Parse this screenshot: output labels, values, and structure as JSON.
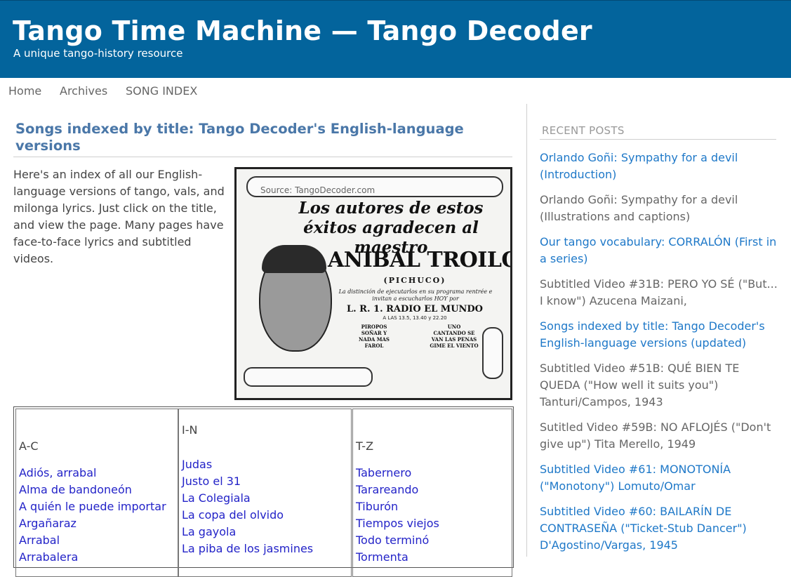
{
  "header": {
    "title": "Tango Time Machine — Tango Decoder",
    "tagline": "A unique tango-history resource",
    "background": "#03649c"
  },
  "nav": {
    "items": [
      {
        "label": "Home"
      },
      {
        "label": "Archives"
      },
      {
        "label": "SONG INDEX"
      }
    ]
  },
  "post": {
    "title": "Songs indexed by title: Tango Decoder's English-language versions",
    "intro": "Here's an index of all our English-language versions of tango, vals, and milonga lyrics. Just click on the title, and view the page. Many pages have face-to-face lyrics and subtitled videos."
  },
  "promo_image": {
    "source": "Source: TangoDecoder.com",
    "headline": "Los autores de estos éxitos agradecen al maestro",
    "name": "ANIBAL TROILO",
    "nickname": "(PICHUCO)",
    "blurb": "La distinción de ejecutarlos en su programa rentrée e invitan a escucharlos HOY por",
    "station": "L. R. 1. RADIO EL MUNDO",
    "times": "A LAS 13.5, 13.40 y 22.20",
    "col_a": [
      "PIROPOS",
      "SOÑAR Y",
      "NADA MAS",
      "FAROL"
    ],
    "col_b": [
      "UNO",
      "CANTANDO SE",
      "VAN LAS PENAS",
      "GIME EL VIENTO"
    ]
  },
  "index": {
    "columns": [
      {
        "heading": "A-C",
        "songs": [
          "Adiós, arrabal",
          "Alma de bandoneón",
          "A quién le puede importar",
          "Argañaraz",
          "Arrabal",
          "Arrabalera"
        ]
      },
      {
        "heading": "I-N",
        "songs": [
          "Judas",
          "Justo el 31",
          "La Colegiala",
          "La copa del olvido",
          "La gayola",
          "La piba de los jasmines"
        ]
      },
      {
        "heading": "T-Z",
        "songs": [
          "Tabernero",
          "Tarareando",
          "Tiburón",
          "Tiempos viejos",
          "Todo terminó",
          "Tormenta"
        ]
      }
    ],
    "link_color": "#2323c8"
  },
  "sidebar": {
    "heading": "RECENT POSTS",
    "posts": [
      {
        "label": "Orlando Goñi: Sympathy for a devil (Introduction)"
      },
      {
        "label": "Orlando Goñi: Sympathy for a devil (Illustrations and captions)"
      },
      {
        "label": "Our tango vocabulary: CORRALÓN (First in a series)"
      },
      {
        "label": "Subtitled Video #31B: PERO YO SÉ (\"But... I know\") Azucena Maizani,"
      },
      {
        "label": "Songs indexed by title: Tango Decoder's English-language versions (updated)"
      },
      {
        "label": "Subtitled Video #51B: QUÉ BIEN TE QUEDA (\"How well it suits you\") Tanturi/Campos, 1943"
      },
      {
        "label": "Sutitled Video #59B: NO AFLOJÉS (\"Don't give up\") Tita Merello, 1949"
      },
      {
        "label": "Subtitled Video #61: MONOTONÍA (\"Monotony\") Lomuto/Omar"
      },
      {
        "label": "Subtitled Video #60: BAILARÍN DE CONTRASEÑA (\"Ticket-Stub Dancer\") D'Agostino/Vargas, 1945"
      }
    ],
    "link_color": "#1e78c8",
    "plain_color": "#666666"
  }
}
